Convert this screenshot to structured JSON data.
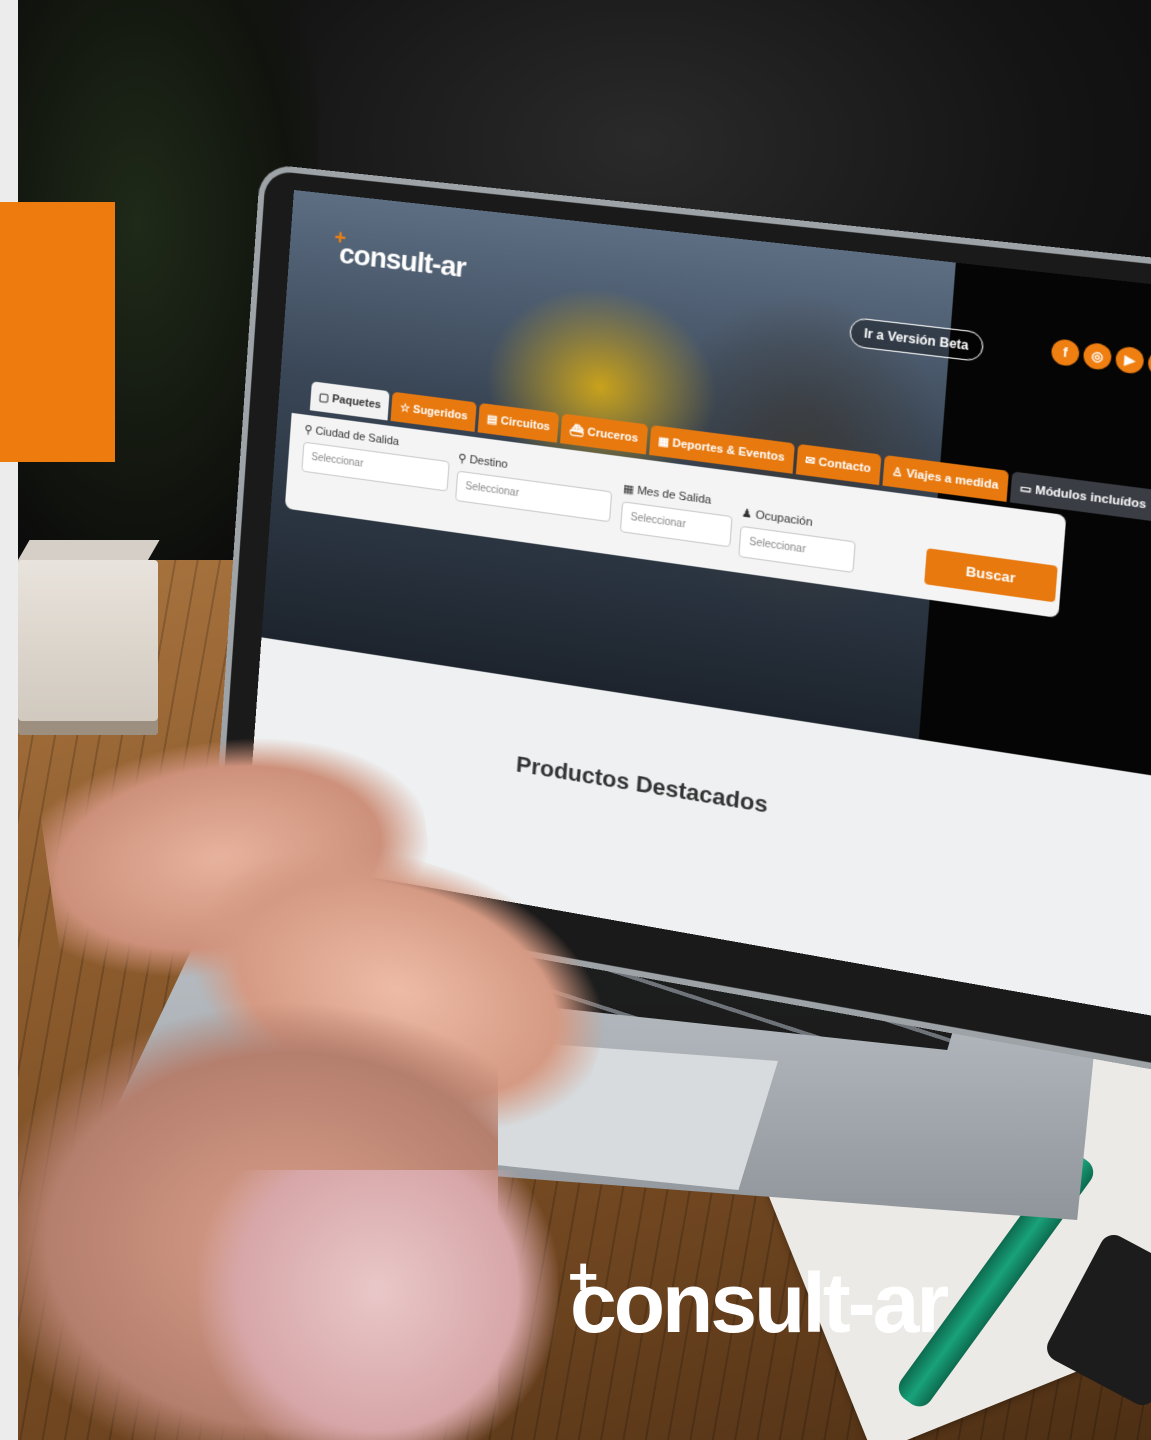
{
  "site": {
    "logo": "consult-ar",
    "beta_button": "Ir a Versión Beta",
    "social": [
      "f",
      "◎",
      "▶",
      "in"
    ],
    "tabs": [
      {
        "label": "Paquetes",
        "icon": "suitcase-icon"
      },
      {
        "label": "Sugeridos",
        "icon": "star-icon"
      },
      {
        "label": "Circuitos",
        "icon": "map-icon"
      },
      {
        "label": "Cruceros",
        "icon": "ship-icon"
      },
      {
        "label": "Deportes & Eventos",
        "icon": "calendar-icon"
      },
      {
        "label": "Contacto",
        "icon": "mail-icon"
      },
      {
        "label": "Viajes a medida",
        "icon": "user-icon"
      },
      {
        "label": "Módulos incluídos",
        "icon": "laptop-icon"
      }
    ],
    "search": {
      "origin_label": "Ciudad de Salida",
      "origin_placeholder": "Seleccionar",
      "destination_label": "Destino",
      "destination_placeholder": "Seleccionar",
      "month_label": "Mes de Salida",
      "month_placeholder": "Seleccionar",
      "occupancy_label": "Ocupación",
      "occupancy_placeholder": "Seleccionar",
      "submit": "Buscar"
    },
    "featured_title": "Productos Destacados"
  },
  "brand": "consult-ar",
  "colors": {
    "accent": "#ee7b0d",
    "tab_dark": "#3a3d44"
  }
}
